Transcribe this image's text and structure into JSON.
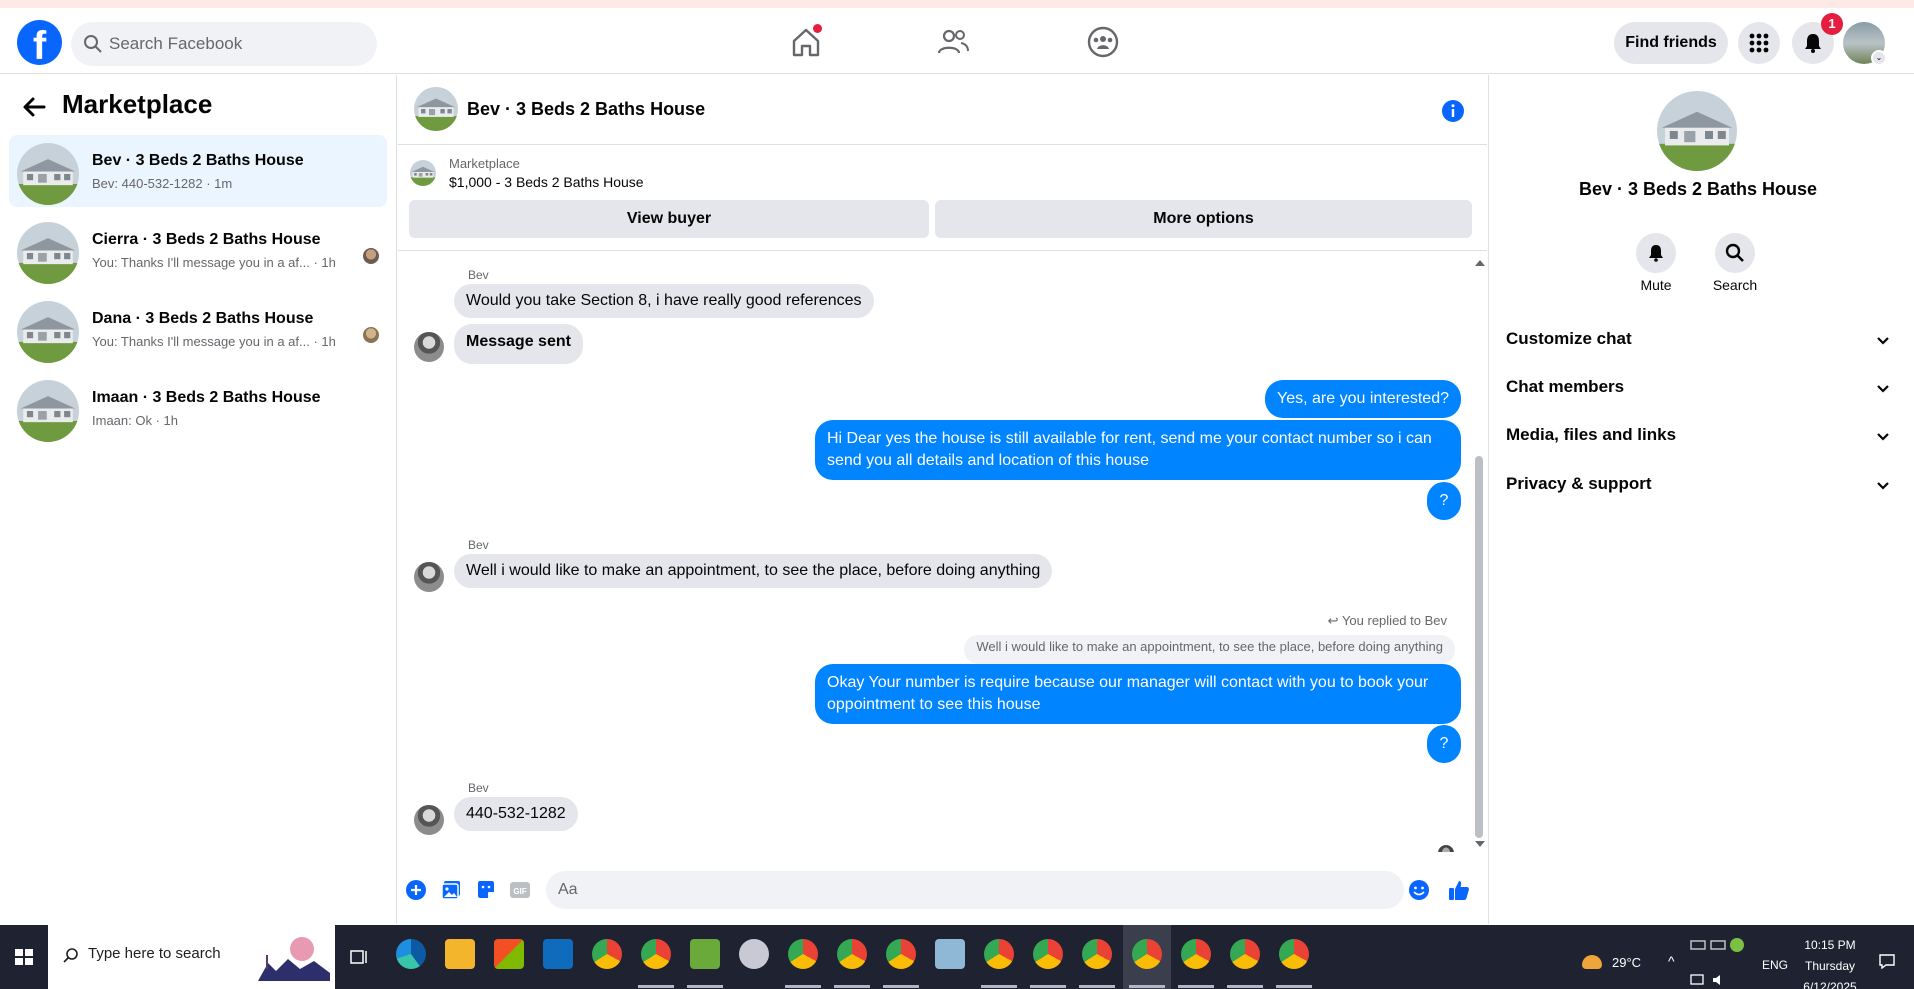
{
  "header": {
    "logo": "f",
    "search_placeholder": "Search Facebook",
    "find_friends": "Find friends",
    "notification_count": "1",
    "avatar_chevron": "⌄"
  },
  "sidebar": {
    "title": "Marketplace",
    "conversations": [
      {
        "name": "Bev · 3 Beds 2 Baths House",
        "preview": "Bev: 440-532-1282 · 1m"
      },
      {
        "name": "Cierra · 3 Beds 2 Baths House",
        "preview": "You: Thanks I'll message you in a af... · 1h"
      },
      {
        "name": "Dana · 3 Beds 2 Baths House",
        "preview": "You: Thanks I'll message you in a af... · 1h"
      },
      {
        "name": "Imaan · 3 Beds 2 Baths House",
        "preview": "Imaan: Ok · 1h"
      }
    ]
  },
  "chat": {
    "title": "Bev · 3 Beds 2 Baths House",
    "listing_source": "Marketplace",
    "listing_price": "$1,000 - 3 Beds 2 Baths House",
    "view_buyer": "View buyer",
    "more_options": "More options",
    "messages": {
      "s1": "Bev",
      "m1": "Would you take Section 8, i have really good references",
      "m2": "Message sent",
      "o1": "Yes, are you interested?",
      "o2": "Hi Dear yes the house is still available for rent, send me your contact number so i can send you all details and location of this house",
      "o3": "?",
      "s2": "Bev",
      "m3": "Well i would like to make an appointment,  to see the place, before doing anything",
      "reply_note": "You replied to Bev",
      "reply_quote": "Well i would like to make an appointment,  to see the place, before doing anything",
      "o4": "Okay Your number is require because our manager will contact with you to book your oppointment to see this house",
      "o5": "?",
      "s3": "Bev",
      "m4": "440-532-1282"
    },
    "composer_placeholder": "Aa"
  },
  "details": {
    "name": "Bev · 3 Beds 2 Baths House",
    "mute": "Mute",
    "search": "Search",
    "sections": [
      "Customize chat",
      "Chat members",
      "Media, files and links",
      "Privacy & support"
    ]
  },
  "taskbar": {
    "search_text": "Type here to search",
    "temperature": "29°C",
    "language": "ENG",
    "time": "10:15 PM",
    "day": "Thursday",
    "date": "6/12/2025"
  },
  "colors": {
    "brand": "#0866ff",
    "outgoing_bubble": "#0084ff",
    "active_conversation": "#ebf5ff",
    "badge": "#e41e3f"
  }
}
